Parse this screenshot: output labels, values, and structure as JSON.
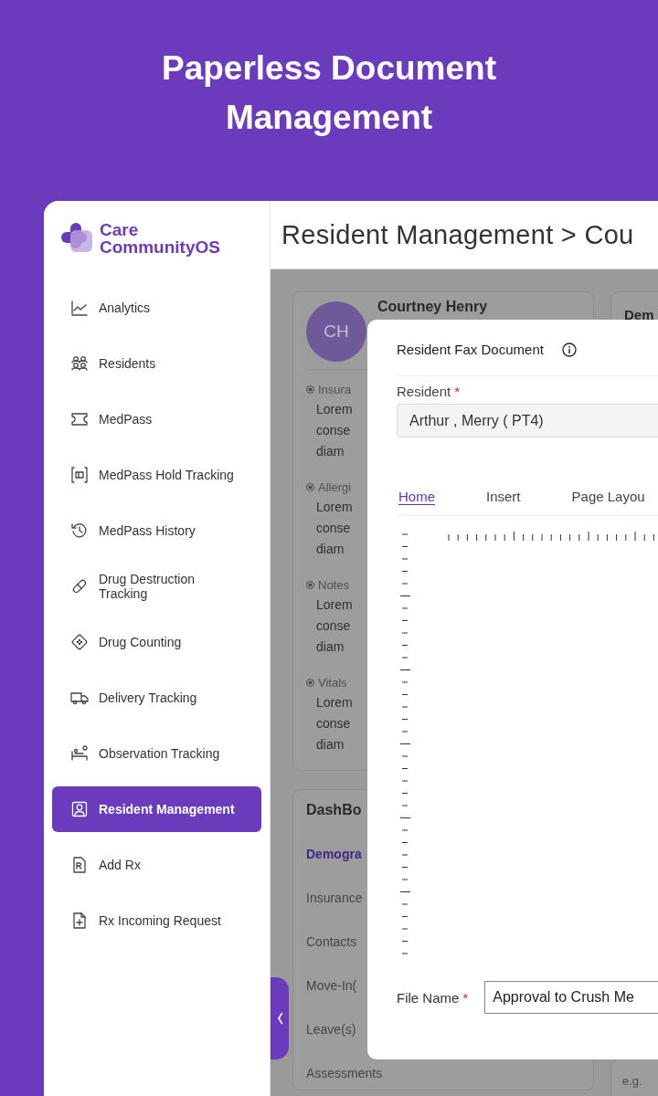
{
  "headline": "Paperless Document Management",
  "brand": {
    "name": "Care CommunityOS"
  },
  "sidebar": {
    "items": [
      {
        "label": "Analytics",
        "selected": false
      },
      {
        "label": "Residents",
        "selected": false
      },
      {
        "label": "MedPass",
        "selected": false
      },
      {
        "label": "MedPass Hold Tracking",
        "selected": false
      },
      {
        "label": "MedPass History",
        "selected": false
      },
      {
        "label": "Drug Destruction Tracking",
        "selected": false
      },
      {
        "label": "Drug Counting",
        "selected": false
      },
      {
        "label": "Delivery Tracking",
        "selected": false
      },
      {
        "label": "Observation Tracking",
        "selected": false
      },
      {
        "label": "Resident Management",
        "selected": true
      },
      {
        "label": "Add Rx",
        "selected": false
      },
      {
        "label": "Rx Incoming Request",
        "selected": false
      }
    ]
  },
  "header": {
    "title": "Resident Management > Cou"
  },
  "profile_card": {
    "initials": "CH",
    "name": "Courtney Henry",
    "sections": [
      {
        "label": "Insura",
        "lines": [
          "Lorem",
          "conse",
          "diam"
        ]
      },
      {
        "label": "Allergi",
        "lines": [
          "Lorem",
          "conse",
          "diam"
        ]
      },
      {
        "label": "Notes",
        "lines": [
          "Lorem",
          "conse",
          "diam"
        ]
      },
      {
        "label": "Vitals",
        "lines": [
          "Lorem",
          "conse",
          "diam"
        ]
      }
    ]
  },
  "dashboard_card": {
    "title": "DashBo",
    "items": [
      {
        "label": "Demogra",
        "selected": true
      },
      {
        "label": "Insurance",
        "selected": false
      },
      {
        "label": "Contacts",
        "selected": false
      },
      {
        "label": "Move-In(",
        "selected": false
      },
      {
        "label": "Leave(s)",
        "selected": false
      },
      {
        "label": "Assessments",
        "selected": false
      }
    ]
  },
  "side_card": {
    "title": "Dem"
  },
  "side_field": {
    "placeholder": "e.g."
  },
  "modal": {
    "title": "Resident Fax Document",
    "resident": {
      "label": "Resident",
      "required_mark": "*",
      "value": "Arthur , Merry ( PT4)"
    },
    "tabs": [
      {
        "label": "Home",
        "selected": true
      },
      {
        "label": "Insert",
        "selected": false
      },
      {
        "label": "Page Layou",
        "selected": false
      }
    ],
    "file_name": {
      "label": "File Name",
      "required_mark": "*",
      "value": "Approval to Crush Me"
    }
  }
}
